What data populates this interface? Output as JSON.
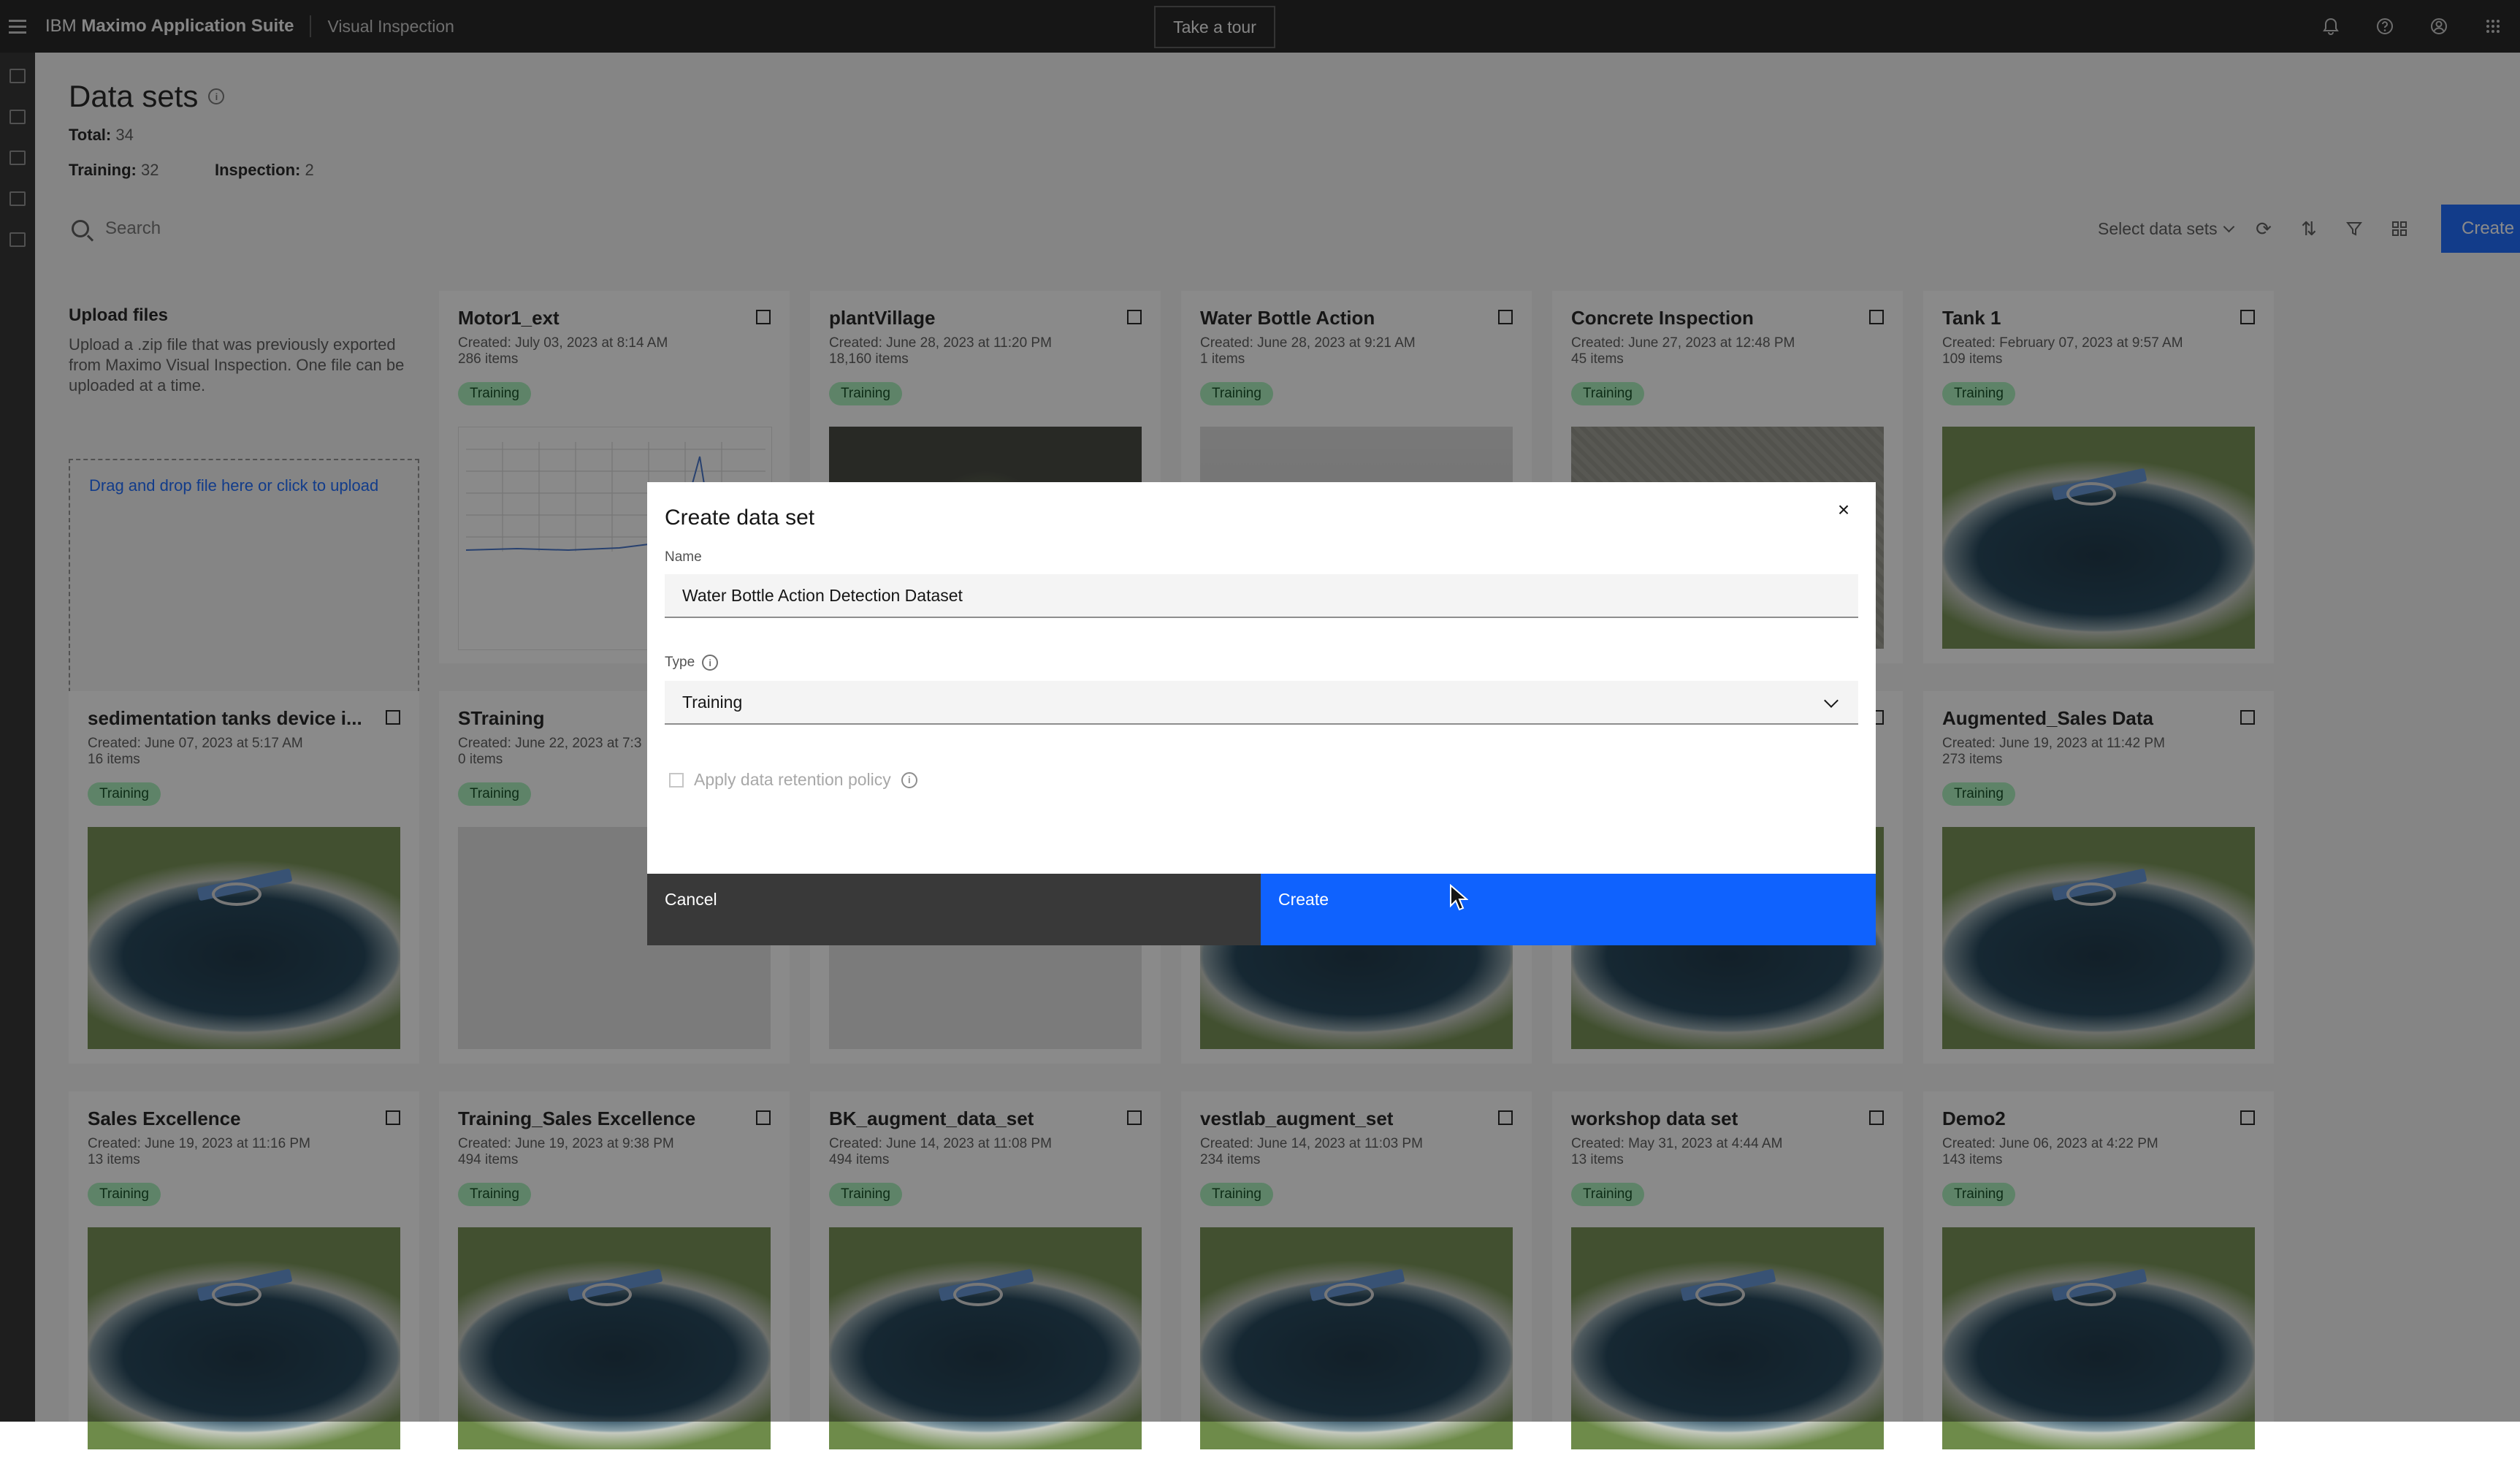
{
  "topbar": {
    "brand_prefix": "IBM",
    "brand_name": "Maximo Application Suite",
    "app_name": "Visual Inspection",
    "tour_label": "Take a tour"
  },
  "page": {
    "title": "Data sets",
    "total_label": "Total:",
    "total_value": "34",
    "training_label": "Training:",
    "training_value": "32",
    "inspection_label": "Inspection:",
    "inspection_value": "2"
  },
  "toolbar": {
    "search_placeholder": "Search",
    "select_label": "Select data sets",
    "create_label": "Create",
    "create_plus": "+"
  },
  "upload": {
    "title": "Upload files",
    "description": "Upload a .zip file that was previously exported from Maximo Visual Inspection. One file can be uploaded at a time.",
    "dropzone_label": "Drag and drop file here or click to upload"
  },
  "cards": [
    {
      "title": "Motor1_ext",
      "created": "Created: July 03, 2023 at 8:14 AM",
      "items": "286 items",
      "tag": "Training",
      "thumb": "chart"
    },
    {
      "title": "plantVillage",
      "created": "Created: June 28, 2023 at 11:20 PM",
      "items": "18,160 items",
      "tag": "Training",
      "thumb": "leaf"
    },
    {
      "title": "Water Bottle Action",
      "created": "Created: June 28, 2023 at 9:21 AM",
      "items": "1 items",
      "tag": "Training",
      "thumb": "water"
    },
    {
      "title": "Concrete Inspection",
      "created": "Created: June 27, 2023 at 12:48 PM",
      "items": "45 items",
      "tag": "Training",
      "thumb": "concrete"
    },
    {
      "title": "Tank 1",
      "created": "Created: February 07, 2023 at 9:57 AM",
      "items": "109 items",
      "tag": "Training",
      "thumb": "tank"
    },
    {
      "title": "sedimentation tanks device i...",
      "created": "Created: June 07, 2023 at 5:17 AM",
      "items": "16 items",
      "tag": "Training",
      "thumb": "tank"
    },
    {
      "title": "STraining",
      "created": "Created: June 22, 2023 at 7:3",
      "items": "0 items",
      "tag": "Training",
      "thumb": "blank"
    },
    {
      "title": "",
      "created": "",
      "items": "",
      "tag": "",
      "thumb": "blank"
    },
    {
      "title": "",
      "created": "",
      "items": "",
      "tag": "",
      "thumb": "tank"
    },
    {
      "title": "",
      "created": "",
      "items": "",
      "tag": "",
      "thumb": "tank"
    },
    {
      "title": "Augmented_Sales Data",
      "created": "Created: June 19, 2023 at 11:42 PM",
      "items": "273 items",
      "tag": "Training",
      "thumb": "tank"
    },
    {
      "title": "Sales Excellence",
      "created": "Created: June 19, 2023 at 11:16 PM",
      "items": "13 items",
      "tag": "Training",
      "thumb": "tank"
    },
    {
      "title": "Training_Sales Excellence",
      "created": "Created: June 19, 2023 at 9:38 PM",
      "items": "494 items",
      "tag": "Training",
      "thumb": "tank"
    },
    {
      "title": "BK_augment_data_set",
      "created": "Created: June 14, 2023 at 11:08 PM",
      "items": "494 items",
      "tag": "Training",
      "thumb": "tank"
    },
    {
      "title": "vestlab_augment_set",
      "created": "Created: June 14, 2023 at 11:03 PM",
      "items": "234 items",
      "tag": "Training",
      "thumb": "tank"
    },
    {
      "title": "workshop data set",
      "created": "Created: May 31, 2023 at 4:44 AM",
      "items": "13 items",
      "tag": "Training",
      "thumb": "tank"
    },
    {
      "title": "Demo2",
      "created": "Created: June 06, 2023 at 4:22 PM",
      "items": "143 items",
      "tag": "Training",
      "thumb": "tank"
    }
  ],
  "modal": {
    "title": "Create data set",
    "name_label": "Name",
    "name_value": "Water Bottle Action Detection Dataset",
    "type_label": "Type",
    "type_value": "Training",
    "retention_label": "Apply data retention policy",
    "cancel_label": "Cancel",
    "create_label": "Create",
    "close_symbol": "×"
  },
  "colors": {
    "primary": "#0f62fe",
    "topbar": "#161616",
    "tag_bg": "#a7f0ba",
    "tag_text": "#044317"
  }
}
